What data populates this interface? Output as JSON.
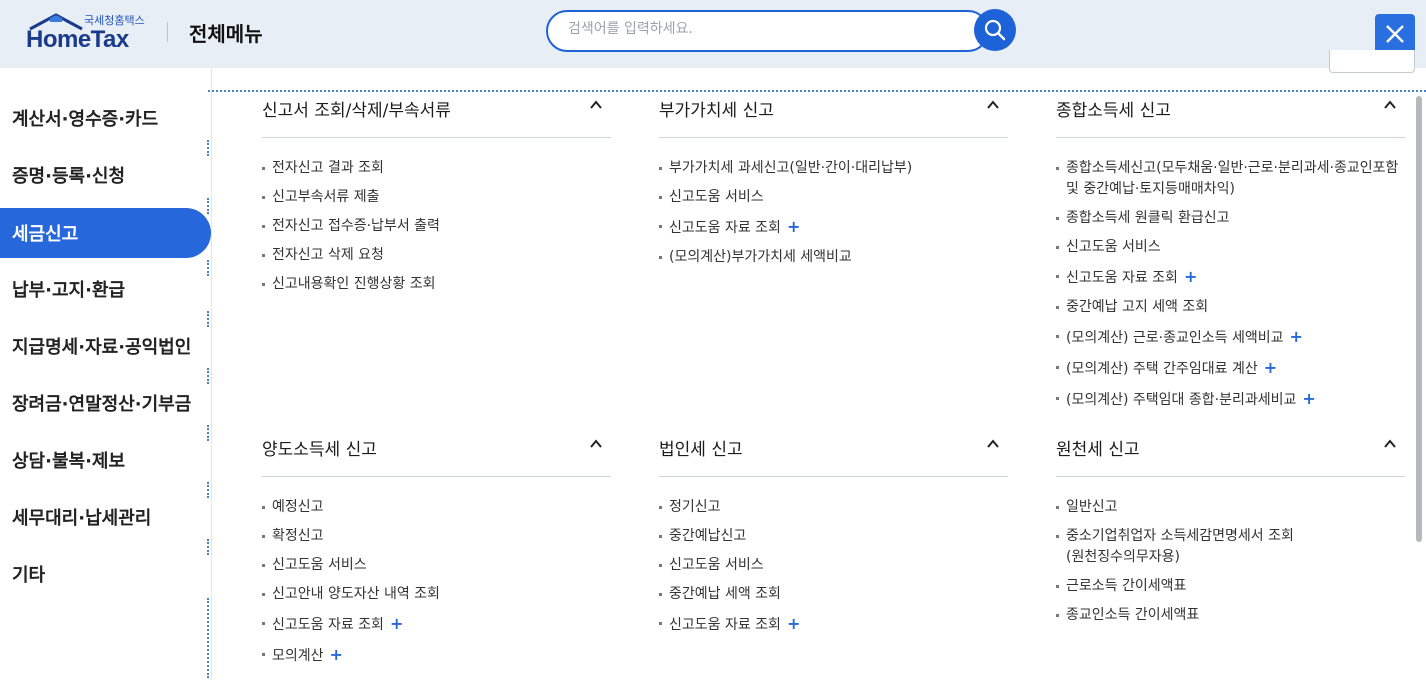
{
  "header": {
    "logo_sub": "국세청홈택스",
    "logo_main": "HomeTax",
    "title": "전체메뉴",
    "search_placeholder": "검색어를 입력하세요.",
    "search_value": ""
  },
  "sidebar": {
    "items": [
      {
        "label": "계산서·영수증·카드",
        "active": false
      },
      {
        "label": "증명·등록·신청",
        "active": false
      },
      {
        "label": "세금신고",
        "active": true
      },
      {
        "label": "납부·고지·환급",
        "active": false
      },
      {
        "label": "지급명세·자료·공익법인",
        "active": false
      },
      {
        "label": "장려금·연말정산·기부금",
        "active": false
      },
      {
        "label": "상담·불복·제보",
        "active": false
      },
      {
        "label": "세무대리·납세관리",
        "active": false
      },
      {
        "label": "기타",
        "active": false
      }
    ]
  },
  "sections": [
    {
      "title": "신고서 조회/삭제/부속서류",
      "items": [
        {
          "label": "전자신고 결과 조회",
          "plus": false
        },
        {
          "label": "신고부속서류 제출",
          "plus": false
        },
        {
          "label": "전자신고 접수증·납부서 출력",
          "plus": false
        },
        {
          "label": "전자신고 삭제 요청",
          "plus": false
        },
        {
          "label": "신고내용확인 진행상황 조회",
          "plus": false
        }
      ]
    },
    {
      "title": "부가가치세 신고",
      "items": [
        {
          "label": "부가가치세 과세신고(일반·간이·대리납부)",
          "plus": false
        },
        {
          "label": "신고도움 서비스",
          "plus": false
        },
        {
          "label": "신고도움 자료 조회",
          "plus": true
        },
        {
          "label": "(모의계산)부가가치세 세액비교",
          "plus": false
        }
      ]
    },
    {
      "title": "종합소득세 신고",
      "items": [
        {
          "label": "종합소득세신고(모두채움·일반·근로·분리과세·종교인포함",
          "label2": "및 중간예납·토지등매매차익)",
          "plus": false
        },
        {
          "label": "종합소득세 원클릭 환급신고",
          "plus": false
        },
        {
          "label": "신고도움 서비스",
          "plus": false
        },
        {
          "label": "신고도움 자료 조회",
          "plus": true
        },
        {
          "label": "중간예납 고지 세액 조회",
          "plus": false
        },
        {
          "label": "(모의계산) 근로·종교인소득 세액비교",
          "plus": true
        },
        {
          "label": "(모의계산) 주택 간주임대료 계산",
          "plus": true
        },
        {
          "label": "(모의계산) 주택임대 종합·분리과세비교",
          "plus": true
        }
      ]
    },
    {
      "title": "양도소득세 신고",
      "items": [
        {
          "label": "예정신고",
          "plus": false
        },
        {
          "label": "확정신고",
          "plus": false
        },
        {
          "label": "신고도움 서비스",
          "plus": false
        },
        {
          "label": "신고안내 양도자산 내역 조회",
          "plus": false
        },
        {
          "label": "신고도움 자료 조회",
          "plus": true
        },
        {
          "label": "모의계산",
          "plus": true
        }
      ]
    },
    {
      "title": "법인세 신고",
      "items": [
        {
          "label": "정기신고",
          "plus": false
        },
        {
          "label": "중간예납신고",
          "plus": false
        },
        {
          "label": "신고도움 서비스",
          "plus": false
        },
        {
          "label": "중간예납 세액 조회",
          "plus": false
        },
        {
          "label": "신고도움 자료 조회",
          "plus": true
        }
      ]
    },
    {
      "title": "원천세 신고",
      "items": [
        {
          "label": "일반신고",
          "plus": false
        },
        {
          "label": "중소기업취업자 소득세감면명세서 조회",
          "label2": "(원천징수의무자용)",
          "plus": false
        },
        {
          "label": "근로소득 간이세액표",
          "plus": false
        },
        {
          "label": "종교인소득 간이세액표",
          "plus": false
        }
      ]
    }
  ],
  "colors": {
    "accent": "#2767dc",
    "header_bg": "#e8eef6",
    "logo": "#1a3b8c"
  },
  "icons": {
    "search": "search-icon",
    "close": "close-icon",
    "caret": "chevron-up-icon",
    "plus": "plus-icon"
  }
}
